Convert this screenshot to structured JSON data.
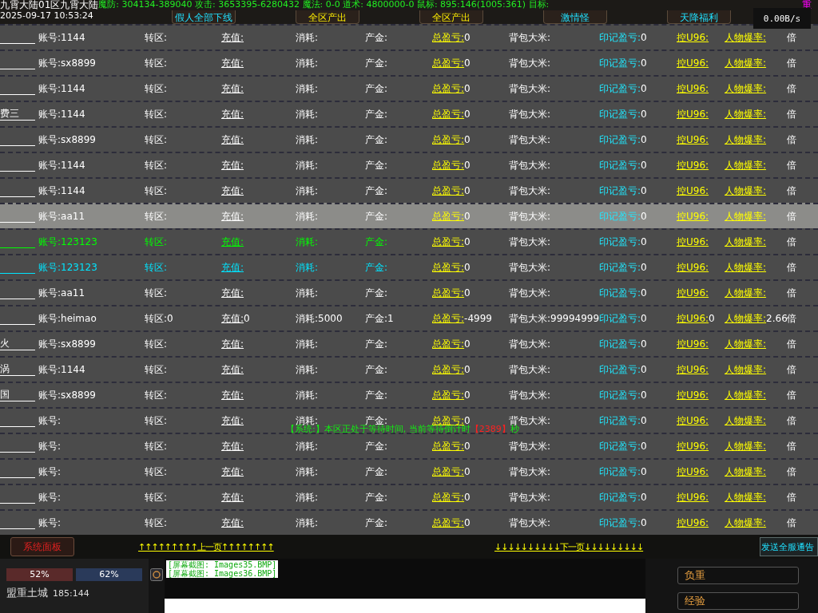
{
  "top_bar": {
    "location": "九霄大陆01区九霄大陆",
    "stats": "魔防: 304134-389040 攻击: 3653395-6280432 魔法: 0-0 道术: 4800000-0 鼠标: 895:146(1005:361) 目标:",
    "datetime": "2025-09-17 10:53:24",
    "buttons": [
      "假人全部下线",
      "全区产出",
      "全区产出",
      "激情怪",
      "天降福利"
    ],
    "corner_text": "重",
    "net_speed": "0.00B/s"
  },
  "rows": [
    {
      "prefix": "",
      "color": "#ffffff",
      "selected": false,
      "cells": [
        {
          "label": "账号:",
          "value": "1144"
        },
        {
          "label": "转区:"
        },
        {
          "label": "充值:"
        },
        {
          "label": "消耗:"
        },
        {
          "label": "产金:"
        },
        {
          "label": "总盈亏:",
          "value": "0"
        },
        {
          "label": "背包大米:"
        },
        {
          "label": "印记盈亏:",
          "value": "0"
        },
        {
          "label": "控U96:"
        },
        {
          "label": "人物爆率:"
        },
        {
          "label": "倍"
        }
      ]
    },
    {
      "prefix": "",
      "color": "#ffffff",
      "selected": false,
      "cells": [
        {
          "label": "账号:",
          "value": "sx8899"
        },
        {
          "label": "转区:"
        },
        {
          "label": "充值:"
        },
        {
          "label": "消耗:"
        },
        {
          "label": "产金:"
        },
        {
          "label": "总盈亏:",
          "value": "0"
        },
        {
          "label": "背包大米:"
        },
        {
          "label": "印记盈亏:",
          "value": "0"
        },
        {
          "label": "控U96:"
        },
        {
          "label": "人物爆率:"
        },
        {
          "label": "倍"
        }
      ]
    },
    {
      "prefix": "",
      "color": "#ffffff",
      "selected": false,
      "cells": [
        {
          "label": "账号:",
          "value": "1144"
        },
        {
          "label": "转区:"
        },
        {
          "label": "充值:"
        },
        {
          "label": "消耗:"
        },
        {
          "label": "产金:"
        },
        {
          "label": "总盈亏:",
          "value": "0"
        },
        {
          "label": "背包大米:"
        },
        {
          "label": "印记盈亏:",
          "value": "0"
        },
        {
          "label": "控U96:"
        },
        {
          "label": "人物爆率:"
        },
        {
          "label": "倍"
        }
      ]
    },
    {
      "prefix": "费三",
      "color": "#ffffff",
      "selected": false,
      "cells": [
        {
          "label": "账号:",
          "value": "1144"
        },
        {
          "label": "转区:"
        },
        {
          "label": "充值:"
        },
        {
          "label": "消耗:"
        },
        {
          "label": "产金:"
        },
        {
          "label": "总盈亏:",
          "value": "0"
        },
        {
          "label": "背包大米:"
        },
        {
          "label": "印记盈亏:",
          "value": "0"
        },
        {
          "label": "控U96:"
        },
        {
          "label": "人物爆率:"
        },
        {
          "label": "倍"
        }
      ]
    },
    {
      "prefix": "",
      "color": "#ffffff",
      "selected": false,
      "cells": [
        {
          "label": "账号:",
          "value": "sx8899"
        },
        {
          "label": "转区:"
        },
        {
          "label": "充值:"
        },
        {
          "label": "消耗:"
        },
        {
          "label": "产金:"
        },
        {
          "label": "总盈亏:",
          "value": "0"
        },
        {
          "label": "背包大米:"
        },
        {
          "label": "印记盈亏:",
          "value": "0"
        },
        {
          "label": "控U96:"
        },
        {
          "label": "人物爆率:"
        },
        {
          "label": "倍"
        }
      ]
    },
    {
      "prefix": "",
      "color": "#ffffff",
      "selected": false,
      "cells": [
        {
          "label": "账号:",
          "value": "1144"
        },
        {
          "label": "转区:"
        },
        {
          "label": "充值:"
        },
        {
          "label": "消耗:"
        },
        {
          "label": "产金:"
        },
        {
          "label": "总盈亏:",
          "value": "0"
        },
        {
          "label": "背包大米:"
        },
        {
          "label": "印记盈亏:",
          "value": "0"
        },
        {
          "label": "控U96:"
        },
        {
          "label": "人物爆率:"
        },
        {
          "label": "倍"
        }
      ]
    },
    {
      "prefix": "",
      "color": "#ffffff",
      "selected": false,
      "cells": [
        {
          "label": "账号:",
          "value": "1144"
        },
        {
          "label": "转区:"
        },
        {
          "label": "充值:"
        },
        {
          "label": "消耗:"
        },
        {
          "label": "产金:"
        },
        {
          "label": "总盈亏:",
          "value": "0"
        },
        {
          "label": "背包大米:"
        },
        {
          "label": "印记盈亏:",
          "value": "0"
        },
        {
          "label": "控U96:"
        },
        {
          "label": "人物爆率:"
        },
        {
          "label": "倍"
        }
      ]
    },
    {
      "prefix": "",
      "color": "#ffffff",
      "selected": true,
      "cells": [
        {
          "label": "账号:",
          "value": "aa11"
        },
        {
          "label": "转区:"
        },
        {
          "label": "充值:"
        },
        {
          "label": "消耗:"
        },
        {
          "label": "产金:"
        },
        {
          "label": "总盈亏:",
          "value": "0"
        },
        {
          "label": "背包大米:"
        },
        {
          "label": "印记盈亏:",
          "value": "0"
        },
        {
          "label": "控U96:"
        },
        {
          "label": "人物爆率:"
        },
        {
          "label": "倍"
        }
      ]
    },
    {
      "prefix": "",
      "color": "#00ff00",
      "selected": false,
      "cells": [
        {
          "label": "账号:",
          "value": "123123"
        },
        {
          "label": "转区:"
        },
        {
          "label": "充值:"
        },
        {
          "label": "消耗:"
        },
        {
          "label": "产金:"
        },
        {
          "label": "总盈亏:",
          "value": "0"
        },
        {
          "label": "背包大米:"
        },
        {
          "label": "印记盈亏:",
          "value": "0"
        },
        {
          "label": "控U96:"
        },
        {
          "label": "人物爆率:"
        },
        {
          "label": "倍"
        }
      ]
    },
    {
      "prefix": "",
      "color": "#00e5ff",
      "selected": false,
      "cells": [
        {
          "label": "账号:",
          "value": "123123"
        },
        {
          "label": "转区:"
        },
        {
          "label": "充值:"
        },
        {
          "label": "消耗:"
        },
        {
          "label": "产金:"
        },
        {
          "label": "总盈亏:",
          "value": "0"
        },
        {
          "label": "背包大米:"
        },
        {
          "label": "印记盈亏:",
          "value": "0"
        },
        {
          "label": "控U96:"
        },
        {
          "label": "人物爆率:"
        },
        {
          "label": "倍"
        }
      ]
    },
    {
      "prefix": "",
      "color": "#ffffff",
      "selected": false,
      "cells": [
        {
          "label": "账号:",
          "value": "aa11"
        },
        {
          "label": "转区:"
        },
        {
          "label": "充值:"
        },
        {
          "label": "消耗:"
        },
        {
          "label": "产金:"
        },
        {
          "label": "总盈亏:",
          "value": "0"
        },
        {
          "label": "背包大米:"
        },
        {
          "label": "印记盈亏:",
          "value": "0"
        },
        {
          "label": "控U96:"
        },
        {
          "label": "人物爆率:"
        },
        {
          "label": "倍"
        }
      ]
    },
    {
      "prefix": "",
      "color": "#ffffff",
      "selected": false,
      "cells": [
        {
          "label": "账号:",
          "value": "heimao"
        },
        {
          "label": "转区:",
          "value": "0"
        },
        {
          "label": "充值:",
          "value": "0"
        },
        {
          "label": "消耗:",
          "value": "5000"
        },
        {
          "label": "产金:",
          "value": "1"
        },
        {
          "label": "总盈亏:",
          "value": "-4999"
        },
        {
          "label": "背包大米:",
          "value": "99994999"
        },
        {
          "label": "印记盈亏:",
          "value": "0"
        },
        {
          "label": "控U96:",
          "value": "0"
        },
        {
          "label": "人物爆率:",
          "value": "2.66"
        },
        {
          "label": "倍"
        }
      ]
    },
    {
      "prefix": "火",
      "color": "#ffffff",
      "selected": false,
      "cells": [
        {
          "label": "账号:",
          "value": "sx8899"
        },
        {
          "label": "转区:"
        },
        {
          "label": "充值:"
        },
        {
          "label": "消耗:"
        },
        {
          "label": "产金:"
        },
        {
          "label": "总盈亏:",
          "value": "0"
        },
        {
          "label": "背包大米:"
        },
        {
          "label": "印记盈亏:",
          "value": "0"
        },
        {
          "label": "控U96:"
        },
        {
          "label": "人物爆率:"
        },
        {
          "label": "倍"
        }
      ]
    },
    {
      "prefix": "涡",
      "color": "#ffffff",
      "selected": false,
      "cells": [
        {
          "label": "账号:",
          "value": "1144"
        },
        {
          "label": "转区:"
        },
        {
          "label": "充值:"
        },
        {
          "label": "消耗:"
        },
        {
          "label": "产金:"
        },
        {
          "label": "总盈亏:",
          "value": "0"
        },
        {
          "label": "背包大米:"
        },
        {
          "label": "印记盈亏:",
          "value": "0"
        },
        {
          "label": "控U96:"
        },
        {
          "label": "人物爆率:"
        },
        {
          "label": "倍"
        }
      ]
    },
    {
      "prefix": "国",
      "color": "#ffffff",
      "selected": false,
      "cells": [
        {
          "label": "账号:",
          "value": "sx8899"
        },
        {
          "label": "转区:"
        },
        {
          "label": "充值:"
        },
        {
          "label": "消耗:"
        },
        {
          "label": "产金:"
        },
        {
          "label": "总盈亏:",
          "value": "0"
        },
        {
          "label": "背包大米:"
        },
        {
          "label": "印记盈亏:",
          "value": "0"
        },
        {
          "label": "控U96:"
        },
        {
          "label": "人物爆率:"
        },
        {
          "label": "倍"
        }
      ]
    },
    {
      "prefix": "",
      "color": "#ffffff",
      "selected": false,
      "cells": [
        {
          "label": "账号:"
        },
        {
          "label": "转区:"
        },
        {
          "label": "充值:"
        },
        {
          "label": "消耗:"
        },
        {
          "label": "产金:"
        },
        {
          "label": "总盈亏:",
          "value": "0"
        },
        {
          "label": "背包大米:"
        },
        {
          "label": "印记盈亏:",
          "value": "0"
        },
        {
          "label": "控U96:"
        },
        {
          "label": "人物爆率:"
        },
        {
          "label": "倍"
        }
      ]
    },
    {
      "prefix": "",
      "color": "#ffffff",
      "selected": false,
      "cells": [
        {
          "label": "账号:"
        },
        {
          "label": "转区:"
        },
        {
          "label": "充值:"
        },
        {
          "label": "消耗:"
        },
        {
          "label": "产金:"
        },
        {
          "label": "总盈亏:",
          "value": "0"
        },
        {
          "label": "背包大米:"
        },
        {
          "label": "印记盈亏:",
          "value": "0"
        },
        {
          "label": "控U96:"
        },
        {
          "label": "人物爆率:"
        },
        {
          "label": "倍"
        }
      ]
    },
    {
      "prefix": "",
      "color": "#ffffff",
      "selected": false,
      "cells": [
        {
          "label": "账号:"
        },
        {
          "label": "转区:"
        },
        {
          "label": "充值:"
        },
        {
          "label": "消耗:"
        },
        {
          "label": "产金:"
        },
        {
          "label": "总盈亏:",
          "value": "0"
        },
        {
          "label": "背包大米:"
        },
        {
          "label": "印记盈亏:",
          "value": "0"
        },
        {
          "label": "控U96:"
        },
        {
          "label": "人物爆率:"
        },
        {
          "label": "倍"
        }
      ]
    },
    {
      "prefix": "",
      "color": "#ffffff",
      "selected": false,
      "cells": [
        {
          "label": "账号:"
        },
        {
          "label": "转区:"
        },
        {
          "label": "充值:"
        },
        {
          "label": "消耗:"
        },
        {
          "label": "产金:"
        },
        {
          "label": "总盈亏:",
          "value": "0"
        },
        {
          "label": "背包大米:"
        },
        {
          "label": "印记盈亏:",
          "value": "0"
        },
        {
          "label": "控U96:"
        },
        {
          "label": "人物爆率:"
        },
        {
          "label": "倍"
        }
      ]
    },
    {
      "prefix": "",
      "color": "#ffffff",
      "selected": false,
      "cells": [
        {
          "label": "账号:"
        },
        {
          "label": "转区:"
        },
        {
          "label": "充值:"
        },
        {
          "label": "消耗:"
        },
        {
          "label": "产金:"
        },
        {
          "label": "总盈亏:",
          "value": "0"
        },
        {
          "label": "背包大米:"
        },
        {
          "label": "印记盈亏:",
          "value": "0"
        },
        {
          "label": "控U96:"
        },
        {
          "label": "人物爆率:"
        },
        {
          "label": "倍"
        }
      ]
    }
  ],
  "system_message": {
    "text": "【系统:】本区正处于等待时间, 当前等待倒计时",
    "count": "【2389】",
    "unit": "秒"
  },
  "pager": {
    "panel_button": "系统面板",
    "prev": "↑↑↑↑↑↑↑↑↑上一页↑↑↑↑↑↑↑↑",
    "next": "↓↓↓↓↓↓↓↓↓↓下一页↓↓↓↓↓↓↓↓↓",
    "broadcast_button": "发送全服通告"
  },
  "status": {
    "hp": "52%",
    "mp": "62%",
    "map": "盟重土城",
    "coords": "185:144"
  },
  "chat": {
    "lines": [
      "[屏幕截图: Images35.BMP]",
      "[屏幕截图: Images36.BMP]"
    ]
  },
  "bars": [
    {
      "label": "负重"
    },
    {
      "label": "经验"
    }
  ]
}
